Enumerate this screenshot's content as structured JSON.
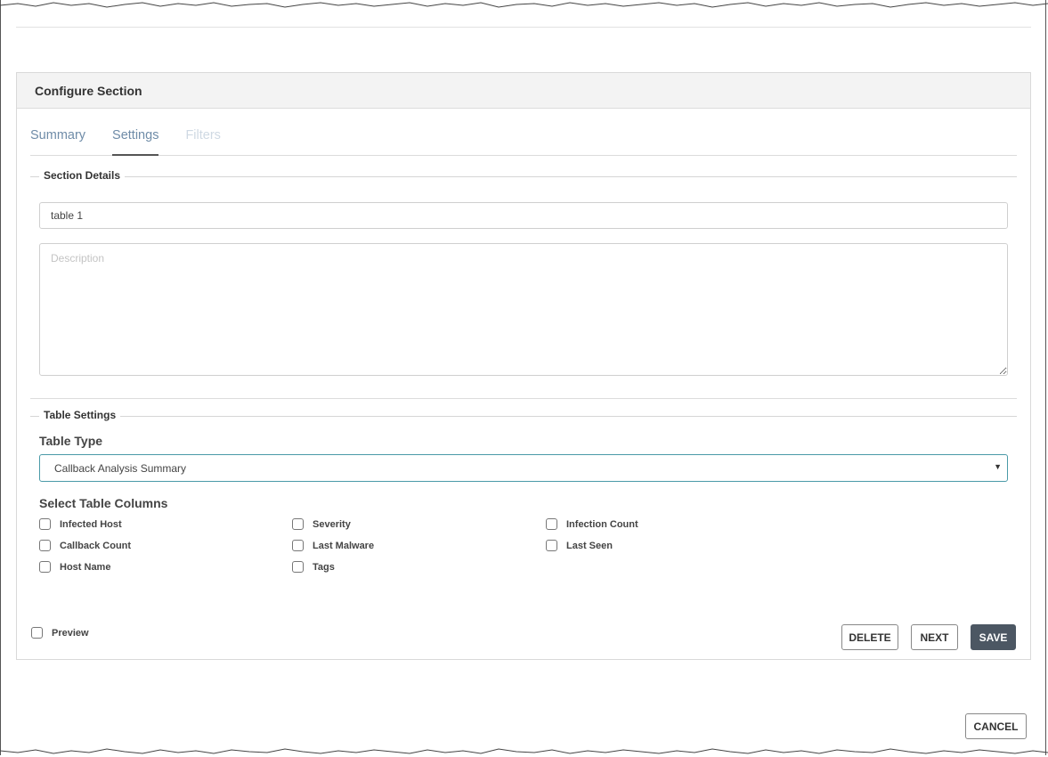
{
  "dialog": {
    "title": "Configure Section",
    "tabs": [
      {
        "label": "Summary",
        "state": "normal"
      },
      {
        "label": "Settings",
        "state": "active"
      },
      {
        "label": "Filters",
        "state": "disabled"
      }
    ],
    "section_details": {
      "legend": "Section Details",
      "name_value": "table 1",
      "description_placeholder": "Description"
    },
    "table_settings": {
      "legend": "Table Settings",
      "table_type_label": "Table Type",
      "table_type_value": "Callback Analysis Summary",
      "columns_label": "Select Table Columns",
      "columns": [
        {
          "label": "Infected Host",
          "checked": false
        },
        {
          "label": "Severity",
          "checked": false
        },
        {
          "label": "Infection Count",
          "checked": false
        },
        {
          "label": "Callback Count",
          "checked": false
        },
        {
          "label": "Last Malware",
          "checked": false
        },
        {
          "label": "Last Seen",
          "checked": false
        },
        {
          "label": "Host Name",
          "checked": false
        },
        {
          "label": "Tags",
          "checked": false
        }
      ]
    },
    "footer": {
      "preview_label": "Preview",
      "delete_label": "DELETE",
      "next_label": "NEXT",
      "save_label": "SAVE"
    }
  },
  "cancel_label": "CANCEL",
  "colors": {
    "accent_tab": "#6f8ca8",
    "select_focus_border": "#4a9aa8",
    "primary_button": "#4c5763"
  }
}
